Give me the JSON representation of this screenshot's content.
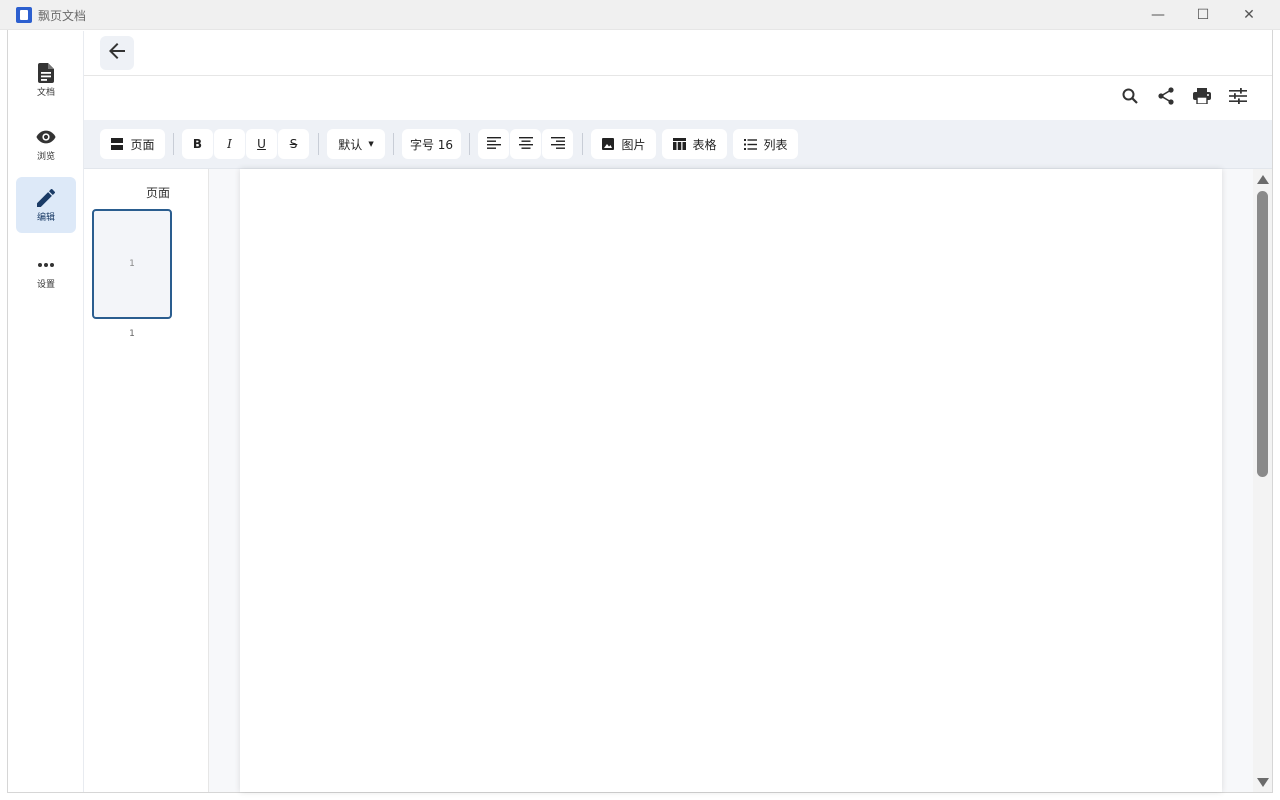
{
  "window": {
    "title": "飘页文档",
    "minimize_glyph": "—",
    "maximize_glyph": "☐",
    "close_glyph": "✕",
    "accent": "#2c5fcf"
  },
  "rail": {
    "items": [
      {
        "label": "文档",
        "icon": "document-icon"
      },
      {
        "label": "浏览",
        "icon": "eye-icon"
      },
      {
        "label": "编辑",
        "icon": "pencil-icon",
        "active": true
      },
      {
        "label": "设置",
        "icon": "more-horiz-icon"
      }
    ]
  },
  "appbar": {
    "back_icon": "arrow-left-icon"
  },
  "actions": {
    "icons": [
      "search-icon",
      "share-icon",
      "print-icon",
      "tune-icon"
    ]
  },
  "toolbar": {
    "page_label": "页面",
    "bold_label": "B",
    "italic_label": "I",
    "underline_label": "U",
    "strike_label": "S",
    "font_select_label": "默认",
    "font_size_label": "字号 16",
    "image_label": "图片",
    "table_label": "表格",
    "list_label": "列表"
  },
  "pages_panel": {
    "title": "页面",
    "thumbnails": [
      {
        "inner_number": "1",
        "caption": "1"
      }
    ]
  }
}
